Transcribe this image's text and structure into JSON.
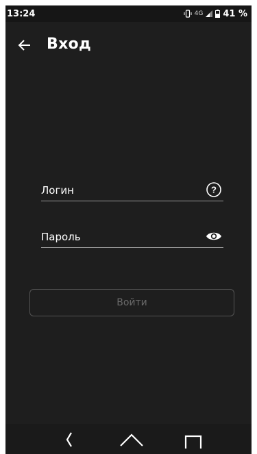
{
  "status_bar": {
    "time": "13:24",
    "network": "4G",
    "battery": "41 %"
  },
  "app_bar": {
    "title": "Вход",
    "back_icon": "arrow-left-icon"
  },
  "form": {
    "login_label": "Логин",
    "login_icon": "help-circle-icon",
    "password_label": "Пароль",
    "password_icon": "eye-icon",
    "submit_label": "Войти"
  },
  "nav_bar": {
    "back_icon": "nav-back-icon",
    "home_icon": "nav-home-icon",
    "recent_icon": "nav-recent-icon"
  },
  "colors": {
    "background": "#1e1e1e",
    "text": "#ffffff",
    "field_line": "#9a9a9a",
    "button_border": "#555555",
    "button_text_disabled": "#6a6a6a"
  }
}
